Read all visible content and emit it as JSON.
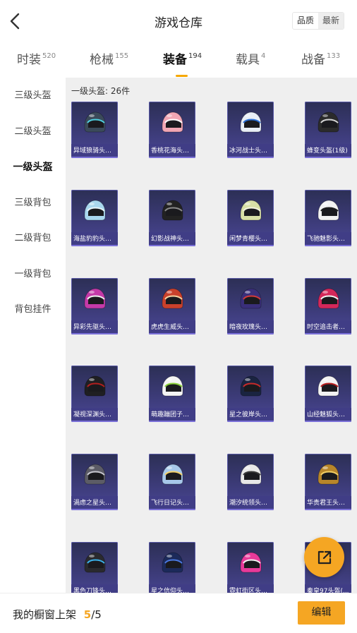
{
  "header": {
    "title": "游戏仓库",
    "sort_options": [
      "品质",
      "最新"
    ]
  },
  "tabs": [
    {
      "label": "时装",
      "count": "520"
    },
    {
      "label": "枪械",
      "count": "155"
    },
    {
      "label": "装备",
      "count": "194"
    },
    {
      "label": "载具",
      "count": "4"
    },
    {
      "label": "战备",
      "count": "133"
    }
  ],
  "active_tab": "装备",
  "sidebar": {
    "items": [
      "三级头盔",
      "二级头盔",
      "一级头盔",
      "三级背包",
      "二级背包",
      "一级背包",
      "背包挂件"
    ],
    "active": "一级头盔"
  },
  "content": {
    "count_label": "一级头盔: 26件",
    "items": [
      {
        "name": "异域狼骑头盔...",
        "color": "#3b4a5a",
        "trim": "#4fd0e0"
      },
      {
        "name": "香桃花海头盔...",
        "color": "#f1a6b4",
        "trim": "#ffffff"
      },
      {
        "name": "冰河战士头盔...",
        "color": "#e8eef6",
        "trim": "#2a6fd6"
      },
      {
        "name": "蜂变头盔(1级)",
        "color": "#2b2b2b",
        "trim": "#d7d7d7"
      },
      {
        "name": "海盐豹豹头盔...",
        "color": "#a9d7ee",
        "trim": "#e8f6fc"
      },
      {
        "name": "幻影战神头盔...",
        "color": "#222222",
        "trim": "#8a8a8a"
      },
      {
        "name": "闲梦青樱头盔...",
        "color": "#d8e0a6",
        "trim": "#f4f4e0"
      },
      {
        "name": "飞驰魅影头盔...",
        "color": "#f2f2f2",
        "trim": "#1c1c1c"
      },
      {
        "name": "异彩先驱头盔...",
        "color": "#c43aa8",
        "trim": "#f0f0f0"
      },
      {
        "name": "虎虎生威头盔...",
        "color": "#c9412c",
        "trim": "#f6d2a0"
      },
      {
        "name": "暗夜玫瑰头盔...",
        "color": "#3a2f7a",
        "trim": "#d23a3a"
      },
      {
        "name": "时空追击者头...",
        "color": "#d4285a",
        "trim": "#f4f4f4"
      },
      {
        "name": "凝视深渊头盔...",
        "color": "#1f1f22",
        "trim": "#b21f1f"
      },
      {
        "name": "萌趣蹦团子头...",
        "color": "#f4f4f4",
        "trim": "#8ad23a"
      },
      {
        "name": "星之彼岸头盔...",
        "color": "#1a2440",
        "trim": "#c82a2a"
      },
      {
        "name": "山经魅狐头盔...",
        "color": "#f2f2f2",
        "trim": "#b81f1f"
      },
      {
        "name": "渦虑之星头盔...",
        "color": "#5c5c66",
        "trim": "#c8c8d0"
      },
      {
        "name": "飞行日记头盔...",
        "color": "#a7c8ea",
        "trim": "#f4d26a"
      },
      {
        "name": "潮汐统领头盔...",
        "color": "#e8e8e8",
        "trim": "#3a3a3a"
      },
      {
        "name": "华贵君王头盔...",
        "color": "#b8862a",
        "trim": "#f2d066"
      },
      {
        "name": "黑色刀锋头盔...",
        "color": "#2a2a2e",
        "trim": "#3ab0e8"
      },
      {
        "name": "星之信仰头盔...",
        "color": "#1c2a5a",
        "trim": "#4a78e0"
      },
      {
        "name": "霓虹街区头盔...",
        "color": "#e83a9a",
        "trim": "#f4f4f4"
      },
      {
        "name": "秦皇97头盔(...",
        "color": "#3a1f1f",
        "trim": "#d4a028"
      }
    ]
  },
  "bottom": {
    "label": "我的橱窗上架",
    "current": "5",
    "sep_total": "/5",
    "edit_label": "编辑"
  },
  "colors": {
    "accent": "#f5a623",
    "card_bg": "#3c3b78",
    "content_bg": "#efefef"
  },
  "icons": {
    "back": "chevron-left-icon",
    "share": "external-link-icon"
  }
}
